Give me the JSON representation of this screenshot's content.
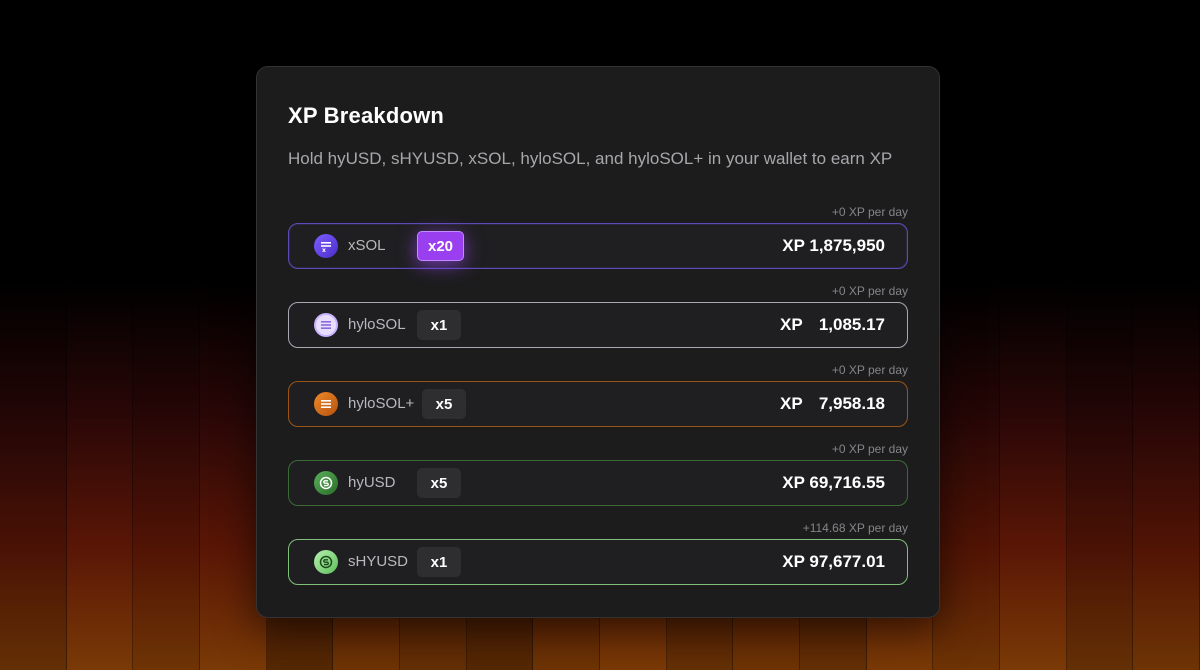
{
  "card": {
    "title": "XP Breakdown",
    "subtitle": "Hold hyUSD, sHYUSD, xSOL, hyloSOL, and hyloSOL+ in your wallet to earn XP"
  },
  "rows": [
    {
      "token": "xSOL",
      "icon": "xsol-icon",
      "multiplier": "x20",
      "xp_label": "XP",
      "xp": "1,875,950",
      "per_day": "+0 XP per day",
      "accent": "#7b5cf0"
    },
    {
      "token": "hyloSOL",
      "icon": "hylosol-icon",
      "multiplier": "x1",
      "xp_label": "XP",
      "xp": "1,085.17",
      "per_day": "+0 XP per day",
      "accent": "#b8b8c4"
    },
    {
      "token": "hyloSOL+",
      "icon": "hylosol-plus-icon",
      "multiplier": "x5",
      "xp_label": "XP",
      "xp": "7,958.18",
      "per_day": "+0 XP per day",
      "accent": "#b8661c"
    },
    {
      "token": "hyUSD",
      "icon": "hyusd-icon",
      "multiplier": "x5",
      "xp_label": "XP",
      "xp": "69,716.55",
      "per_day": "+0 XP per day",
      "accent": "#3f7a3c"
    },
    {
      "token": "sHYUSD",
      "icon": "shyusd-icon",
      "multiplier": "x1",
      "xp_label": "XP",
      "xp": "97,677.01",
      "per_day": "+114.68 XP per day",
      "accent": "#8fd08a"
    }
  ]
}
